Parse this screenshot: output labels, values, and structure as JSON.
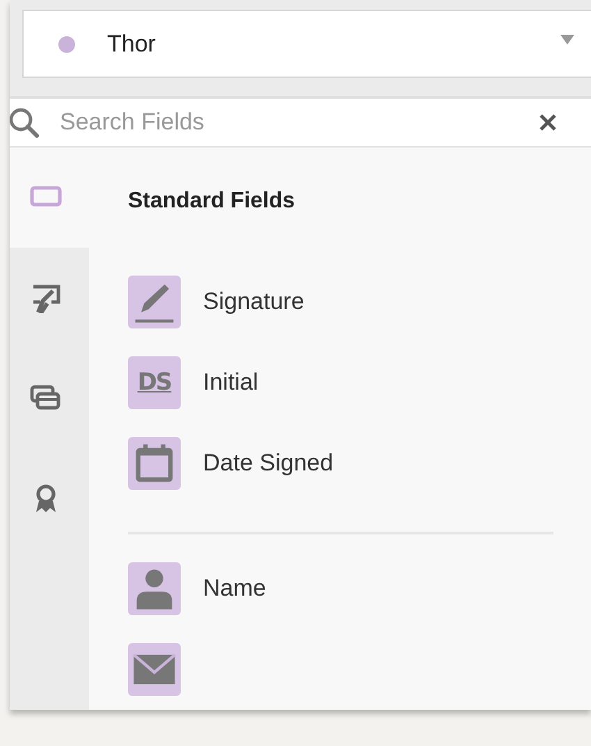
{
  "recipient": {
    "name": "Thor",
    "color": "#c9b3d9"
  },
  "search": {
    "placeholder": "Search Fields"
  },
  "rail_tabs": [
    {
      "kind": "field",
      "selected": true
    },
    {
      "kind": "tools",
      "selected": false
    },
    {
      "kind": "cards",
      "selected": false
    },
    {
      "kind": "ribbon",
      "selected": false
    }
  ],
  "sections": [
    {
      "title": "Standard Fields",
      "items": [
        {
          "kind": "signature",
          "label": "Signature"
        },
        {
          "kind": "initial",
          "icon_text": "DS",
          "label": "Initial"
        },
        {
          "kind": "calendar",
          "label": "Date Signed"
        }
      ]
    },
    {
      "items": [
        {
          "kind": "person",
          "label": "Name"
        },
        {
          "kind": "envelope"
        }
      ]
    }
  ]
}
